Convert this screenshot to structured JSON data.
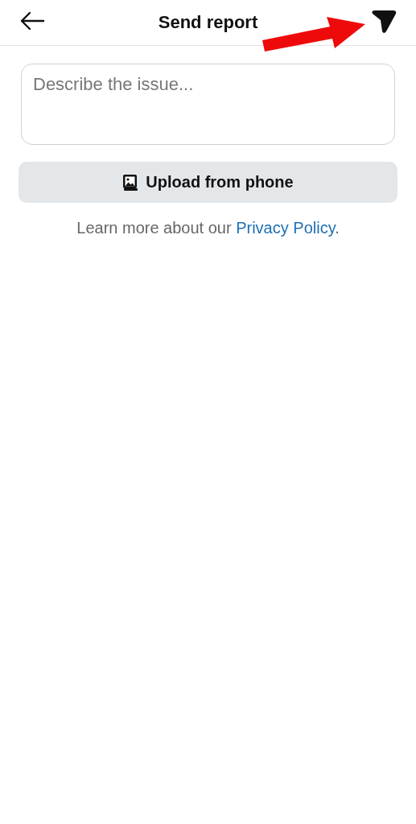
{
  "header": {
    "title": "Send report"
  },
  "description_field": {
    "placeholder": "Describe the issue..."
  },
  "upload_button": {
    "label": "Upload from phone"
  },
  "privacy_note": {
    "text": "Learn more about our ",
    "link": "Privacy Policy",
    "after": "."
  }
}
